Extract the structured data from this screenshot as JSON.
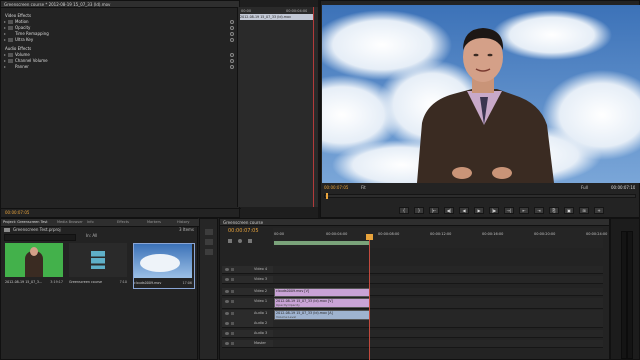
{
  "effect_controls": {
    "header": "Greenscreen course * 2012-08-19 15_07_33 (ld).mov",
    "section_video": "Video Effects",
    "video_items": [
      {
        "label": "Motion",
        "has_fx": true
      },
      {
        "label": "Opacity",
        "has_fx": true
      },
      {
        "label": "Time Remapping",
        "has_fx": false
      },
      {
        "label": "Ultra Key",
        "has_fx": true
      }
    ],
    "section_audio": "Audio Effects",
    "audio_items": [
      {
        "label": "Volume",
        "has_fx": true
      },
      {
        "label": "Channel Volume",
        "has_fx": true
      },
      {
        "label": "Panner",
        "has_fx": false
      }
    ],
    "ruler_start": "00:00",
    "ruler_end": "00:00:04:00",
    "clip_name": "2012-08-19 15_07_33 (ld).mov",
    "timecode": "00:00:07:05"
  },
  "program_monitor": {
    "timecode_left": "00:00:07:05",
    "fit": "Fit",
    "quality": "Full",
    "timecode_right": "00:00:07:10",
    "transport_buttons": [
      "{",
      "}",
      "|←",
      "◀|",
      "◀",
      "▶",
      "|▶",
      "→|",
      "⇤",
      "⇥",
      "⎘",
      "▣",
      "⊞",
      "+"
    ]
  },
  "project_panel": {
    "tabs": [
      "Project: Greenscreen Test",
      "Media Browser",
      "Info",
      "Effects",
      "Markers",
      "History"
    ],
    "project_file": "Greenscreen Test.prproj",
    "items_count": "3 Items",
    "search_hint": "In: All",
    "items": [
      {
        "name": "2012-08-19 15_07_3...",
        "duration": "3:19:17",
        "kind": "greenscreen-clip"
      },
      {
        "name": "Greenscreen course",
        "duration": "7:10",
        "kind": "sequence"
      },
      {
        "name": "clouds0009.mov",
        "duration": "17:06",
        "kind": "clouds-clip"
      }
    ]
  },
  "timeline": {
    "tab": "Greenscreen course",
    "timecode": "00:00:07:05",
    "ruler_labels": [
      "00:00",
      "00:00:04:00",
      "00:00:08:00",
      "00:00:12:00",
      "00:00:16:00",
      "00:00:20:00",
      "00:00:24:00"
    ],
    "tracks": [
      "Video 4",
      "Video 3",
      "Video 2",
      "Video 1",
      "Audio 1",
      "Audio 2",
      "Audio 3",
      "Master"
    ],
    "clip_video2": "clouds0009.mov [V]",
    "clip_video1": "2012-08-19 15_07_33 (ld).mov [V]",
    "clip_video1_fx": "Opacity:Opacity",
    "clip_audio1": "2012-08-19 15_07_33 (ld).mov [A]",
    "clip_audio1_fx": "Volume:Level"
  },
  "colors": {
    "accent_timecode": "#e8a33c",
    "clip_video": "#c9a3d6",
    "clip_audio": "#9fb3cf",
    "sky": "#4f86c6"
  }
}
